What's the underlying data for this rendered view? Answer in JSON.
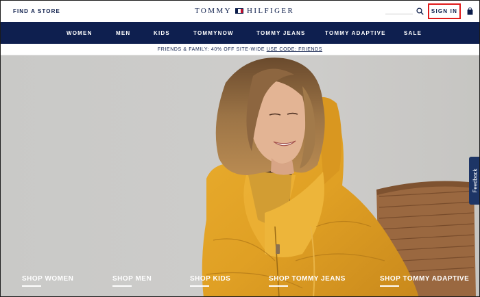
{
  "header": {
    "find_store": "FIND A STORE",
    "logo_left": "TOMMY",
    "logo_right": "HILFIGER",
    "sign_in": "SIGN IN"
  },
  "nav": {
    "items": [
      {
        "label": "WOMEN"
      },
      {
        "label": "MEN"
      },
      {
        "label": "KIDS"
      },
      {
        "label": "TOMMYNOW"
      },
      {
        "label": "TOMMY JEANS"
      },
      {
        "label": "TOMMY ADAPTIVE"
      },
      {
        "label": "SALE"
      }
    ]
  },
  "promo": {
    "text": "FRIENDS & FAMILY: 40% OFF SITE-WIDE ",
    "link": "USE CODE: FRIENDS"
  },
  "hero": {
    "links": [
      {
        "label": "SHOP WOMEN"
      },
      {
        "label": "SHOP MEN"
      },
      {
        "label": "SHOP KIDS"
      },
      {
        "label": "SHOP TOMMY JEANS"
      },
      {
        "label": "SHOP TOMMY ADAPTIVE"
      }
    ]
  },
  "feedback": {
    "label": "Feedback"
  },
  "colors": {
    "navy": "#0e1f4f",
    "accent_red": "#c8102e",
    "highlight_red": "#e01919",
    "jacket": "#e2a227"
  },
  "icons": [
    "search-icon",
    "bag-icon",
    "flag-icon"
  ]
}
